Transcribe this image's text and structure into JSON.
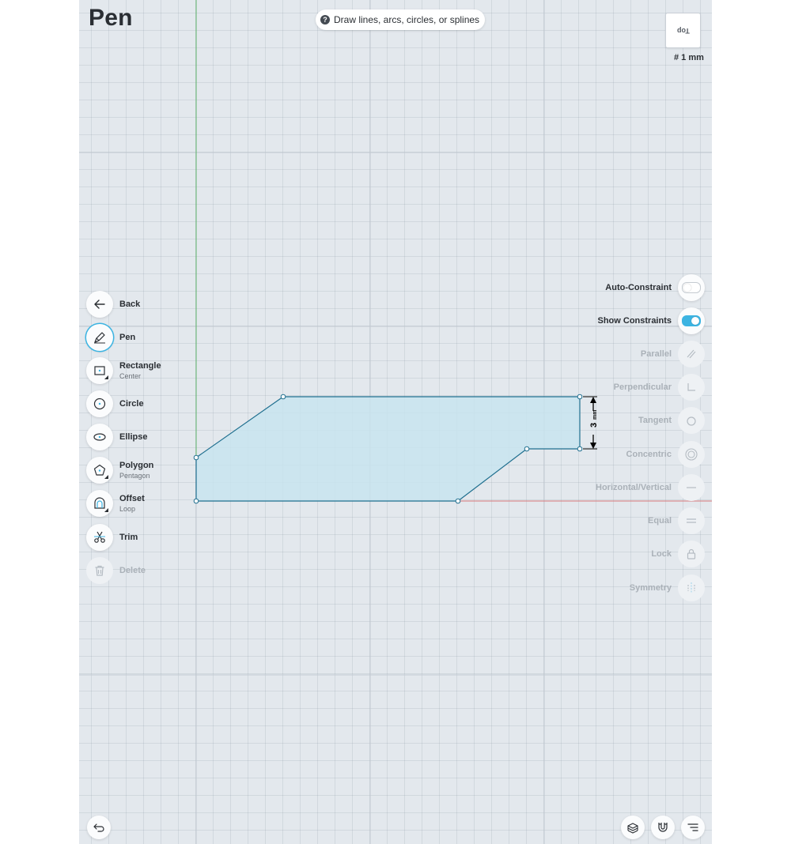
{
  "page": {
    "title": "Pen"
  },
  "hint": {
    "icon": "question-icon",
    "text": "Draw lines, arcs, circles, or splines"
  },
  "view_cube": {
    "label": "Top"
  },
  "grid_scale": {
    "text": "# 1 mm"
  },
  "dimension": {
    "value": "3",
    "unit": "mm"
  },
  "colors": {
    "accent": "#3cb4e2",
    "profile_fill": "#c8e4ef",
    "profile_stroke": "#1f6f8f",
    "axis_y": "#5db36a",
    "axis_x": "#d9777a"
  },
  "tools": [
    {
      "label": "Back",
      "sub": "",
      "icon": "arrow-left-icon"
    },
    {
      "label": "Pen",
      "sub": "",
      "icon": "pen-icon",
      "active": true
    },
    {
      "label": "Rectangle",
      "sub": "Center",
      "icon": "rectangle-icon"
    },
    {
      "label": "Circle",
      "sub": "",
      "icon": "circle-icon"
    },
    {
      "label": "Ellipse",
      "sub": "",
      "icon": "ellipse-icon"
    },
    {
      "label": "Polygon",
      "sub": "Pentagon",
      "icon": "polygon-icon"
    },
    {
      "label": "Offset",
      "sub": "Loop",
      "icon": "offset-icon"
    },
    {
      "label": "Trim",
      "sub": "",
      "icon": "scissors-icon"
    },
    {
      "label": "Delete",
      "sub": "",
      "icon": "trash-icon",
      "disabled": true
    }
  ],
  "constraints": [
    {
      "label": "Auto-Constraint",
      "type": "toggle",
      "state": "off"
    },
    {
      "label": "Show Constraints",
      "type": "toggle",
      "state": "on"
    },
    {
      "label": "Parallel",
      "icon": "parallel-icon"
    },
    {
      "label": "Perpendicular",
      "icon": "perpendicular-icon"
    },
    {
      "label": "Tangent",
      "icon": "tangent-icon"
    },
    {
      "label": "Concentric",
      "icon": "concentric-icon"
    },
    {
      "label": "Horizontal/Vertical",
      "icon": "horizontal-vertical-icon"
    },
    {
      "label": "Equal",
      "icon": "equal-icon"
    },
    {
      "label": "Lock",
      "icon": "lock-icon"
    },
    {
      "label": "Symmetry",
      "icon": "symmetry-icon"
    }
  ],
  "bottom": {
    "undo": "undo-icon",
    "layers": "layers-icon",
    "snap": "magnet-icon",
    "menu": "menu-icon"
  }
}
